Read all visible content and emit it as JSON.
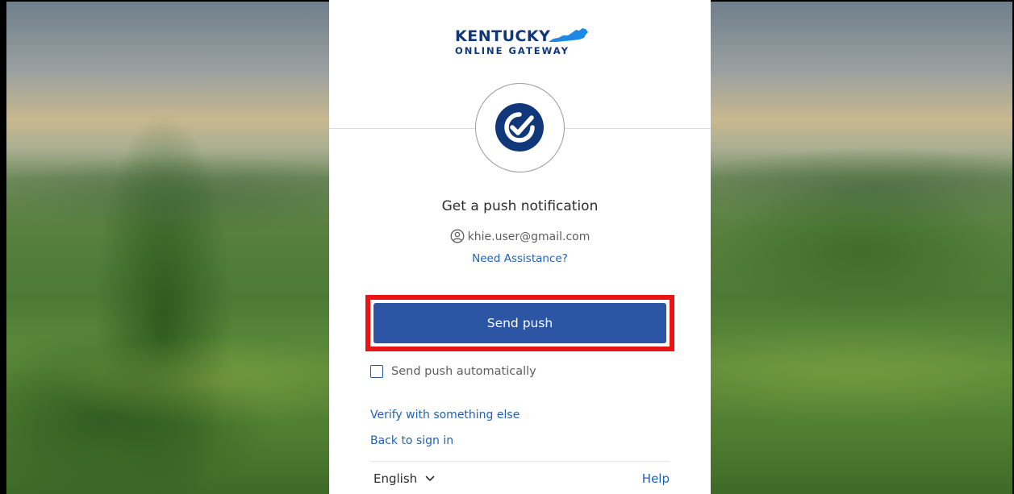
{
  "logo": {
    "line1": "KENTUCKY",
    "line2": "ONLINE GATEWAY",
    "brand_color": "#10377a",
    "accent_color": "#1e88e5"
  },
  "factor": {
    "icon": "okta-verify-check-icon",
    "color": "#10377a"
  },
  "title": "Get a push notification",
  "identity": {
    "icon": "user-icon",
    "email": "khie.user@gmail.com"
  },
  "assistance_link": "Need Assistance?",
  "send_button": {
    "label": "Send push",
    "color": "#2c56a3",
    "highlighted": true,
    "highlight_color": "#ea1414"
  },
  "auto_push": {
    "label": "Send push automatically",
    "checked": false
  },
  "links": {
    "verify_other": "Verify with something else",
    "back_to_sign_in": "Back to sign in"
  },
  "footer": {
    "language": "English",
    "help": "Help"
  }
}
